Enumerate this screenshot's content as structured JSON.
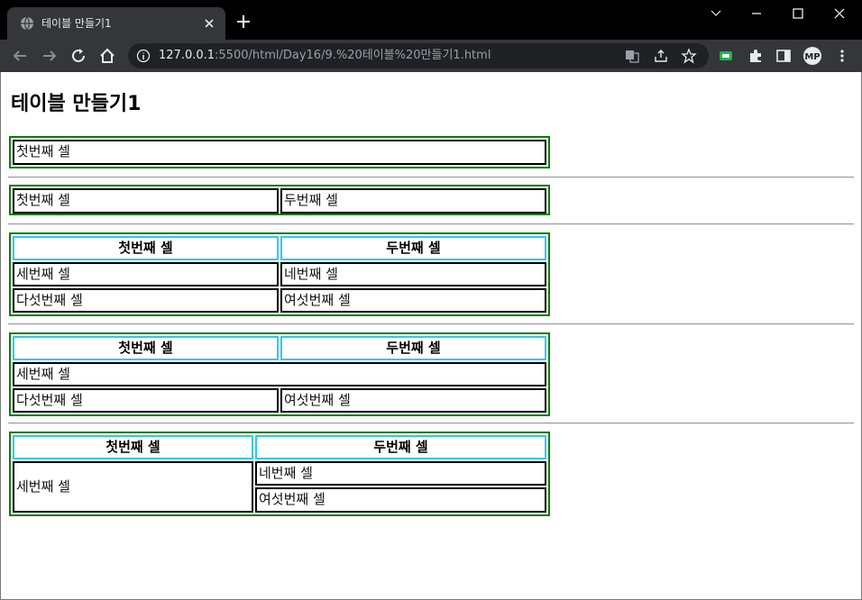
{
  "browser": {
    "tab_title": "테이블 만들기1",
    "url_host": "127.0.0.1",
    "url_rest": ":5500/html/Day16/9.%20테이블%20만들기1.html"
  },
  "page": {
    "heading": "테이블 만들기1",
    "tables": [
      {
        "cells": [
          "첫번째 셀"
        ]
      },
      {
        "cells": [
          "첫번째 셀",
          "두번째 셀"
        ]
      },
      {
        "headers": [
          "첫번째 셀",
          "두번째 셀"
        ],
        "rows": [
          [
            "세번째 셀",
            "네번째 셀"
          ],
          [
            "다섯번째 셀",
            "여섯번째 셀"
          ]
        ]
      },
      {
        "headers": [
          "첫번째 셀",
          "두번째 셀"
        ],
        "rows": [
          [
            "세번째 셀"
          ],
          [
            "다섯번째 셀",
            "여섯번째 셀"
          ]
        ]
      },
      {
        "headers": [
          "첫번째 셀",
          "두번째 셀"
        ],
        "rows": [
          [
            "세번째 셀",
            "네번째 셀"
          ],
          [
            "여섯번째 셀"
          ]
        ]
      }
    ]
  },
  "colors": {
    "table_border": "#0a7d0a",
    "th_border": "#33c6f2",
    "td_border": "#000000"
  }
}
